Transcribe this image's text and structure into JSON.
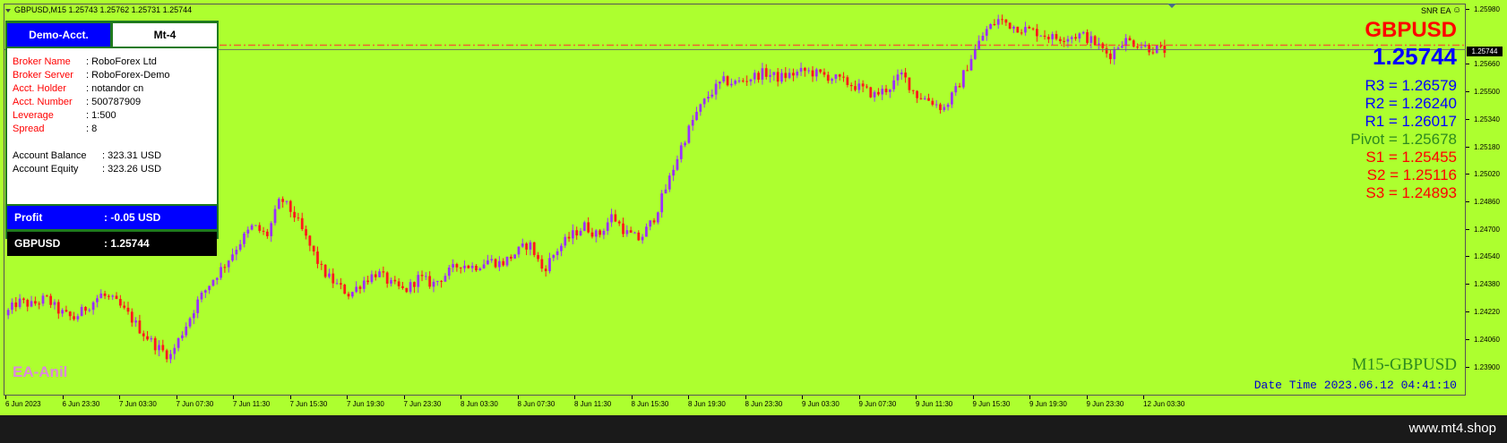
{
  "header": {
    "symbol_info": "GBPUSD,M15  1.25743 1.25762 1.25731 1.25744",
    "ea_name": "SNR EA",
    "ea_icon": "smiley-icon"
  },
  "account_panel": {
    "tab_demo": "Demo-Acct.",
    "tab_platform": "Mt-4",
    "rows": [
      {
        "label": "Broker Name",
        "value": ": RoboForex Ltd"
      },
      {
        "label": "Broker Server",
        "value": ": RoboForex-Demo"
      },
      {
        "label": "Acct. Holder",
        "value": ": notandor cn"
      },
      {
        "label": "Acct. Number",
        "value": ": 500787909"
      },
      {
        "label": "Leverage",
        "value": ": 1:500"
      },
      {
        "label": "Spread",
        "value": ": 8"
      }
    ],
    "balance_label": "Account Balance",
    "balance_value": ": 323.31 USD",
    "equity_label": "Account Equity",
    "equity_value": ": 323.26 USD",
    "profit_label": "Profit",
    "profit_value": ": -0.05 USD",
    "symbol_label": "GBPUSD",
    "symbol_value": ": 1.25744"
  },
  "overlay": {
    "symbol": "GBPUSD",
    "price": "1.25744",
    "r3": "R3 = 1.26579",
    "r2": "R2 = 1.26240",
    "r1": "R1 = 1.26017",
    "pivot": "Pivot = 1.25678",
    "s1": "S1 = 1.25455",
    "s2": "S2 = 1.25116",
    "s3": "S3 = 1.24893",
    "timeframe": "M15-GBPUSD",
    "datetime": "Date Time 2023.06.12 04:41:10",
    "brand": "EA-Anil"
  },
  "colors": {
    "chart_bg": "#adff2f",
    "bull_candle": "#9b30ff",
    "bear_candle": "#ff1a1a",
    "resistance": "#0000ff",
    "pivot": "#2d8a1f",
    "support": "#ff0000"
  },
  "price_scale": {
    "current_tag": "1.25744",
    "ticks": [
      "1.25980",
      "1.25660",
      "1.25500",
      "1.25340",
      "1.25180",
      "1.25020",
      "1.24860",
      "1.24700",
      "1.24540",
      "1.24380",
      "1.24220",
      "1.24060",
      "1.23900"
    ]
  },
  "time_scale": {
    "ticks": [
      "6 Jun 2023",
      "6 Jun 23:30",
      "7 Jun 03:30",
      "7 Jun 07:30",
      "7 Jun 11:30",
      "7 Jun 15:30",
      "7 Jun 19:30",
      "7 Jun 23:30",
      "8 Jun 03:30",
      "8 Jun 07:30",
      "8 Jun 11:30",
      "8 Jun 15:30",
      "8 Jun 19:30",
      "8 Jun 23:30",
      "9 Jun 03:30",
      "9 Jun 07:30",
      "9 Jun 11:30",
      "9 Jun 15:30",
      "9 Jun 19:30",
      "9 Jun 23:30",
      "12 Jun 03:30"
    ]
  },
  "chart_data": {
    "type": "candlestick",
    "symbol": "GBPUSD",
    "timeframe": "M15",
    "ylim": [
      1.239,
      1.2598
    ],
    "current_price": 1.25744,
    "close_path": [
      1.242,
      1.2428,
      1.2426,
      1.243,
      1.2422,
      1.2418,
      1.2425,
      1.2432,
      1.2428,
      1.242,
      1.241,
      1.2402,
      1.2396,
      1.2412,
      1.2428,
      1.244,
      1.245,
      1.2462,
      1.2472,
      1.2466,
      1.2488,
      1.2478,
      1.2462,
      1.2446,
      1.2438,
      1.2432,
      1.244,
      1.2445,
      1.2438,
      1.2434,
      1.2442,
      1.2438,
      1.2444,
      1.245,
      1.2448,
      1.2452,
      1.245,
      1.2456,
      1.2462,
      1.2446,
      1.2458,
      1.2466,
      1.2472,
      1.2466,
      1.2478,
      1.2468,
      1.2464,
      1.2476,
      1.2496,
      1.2518,
      1.2536,
      1.2548,
      1.2556,
      1.2555,
      1.2558,
      1.2561,
      1.2558,
      1.256,
      1.2562,
      1.256,
      1.2558,
      1.2555,
      1.2552,
      1.2548,
      1.2552,
      1.256,
      1.2548,
      1.2545,
      1.254,
      1.2552,
      1.257,
      1.2585,
      1.2592,
      1.2588,
      1.2586,
      1.2584,
      1.2581,
      1.2582,
      1.2583,
      1.2578,
      1.2571,
      1.258,
      1.2578,
      1.2575,
      1.2574
    ]
  }
}
